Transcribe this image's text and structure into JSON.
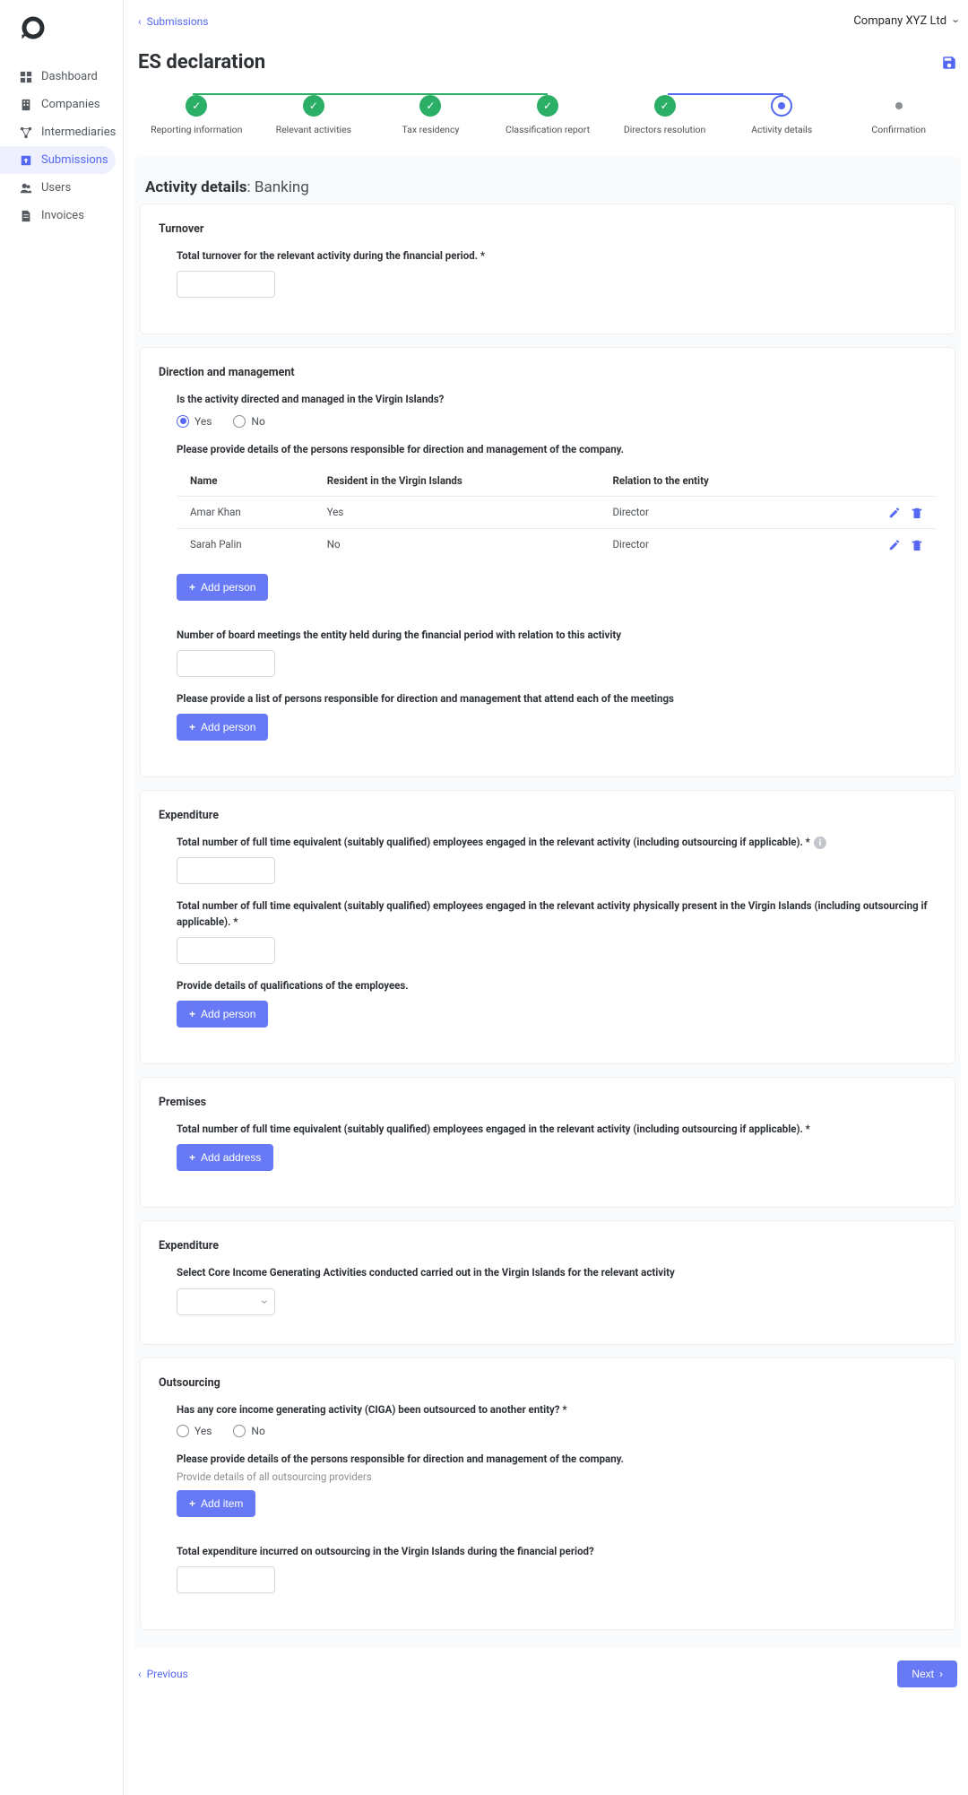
{
  "sidebar": {
    "items": [
      {
        "label": "Dashboard",
        "icon": "dashboard"
      },
      {
        "label": "Companies",
        "icon": "companies"
      },
      {
        "label": "Intermediaries",
        "icon": "intermediaries"
      },
      {
        "label": "Submissions",
        "icon": "submissions",
        "active": true
      },
      {
        "label": "Users",
        "icon": "users"
      },
      {
        "label": "Invoices",
        "icon": "invoices"
      }
    ]
  },
  "topbar": {
    "back_label": "Submissions",
    "company": "Company XYZ Ltd"
  },
  "header": {
    "title": "ES declaration"
  },
  "stepper": [
    {
      "label": "Reporting information",
      "state": "done"
    },
    {
      "label": "Relevant activities",
      "state": "done"
    },
    {
      "label": "Tax residency",
      "state": "done"
    },
    {
      "label": "Classification report",
      "state": "done"
    },
    {
      "label": "Directors resolution",
      "state": "done"
    },
    {
      "label": "Activity details",
      "state": "current"
    },
    {
      "label": "Confirmation",
      "state": "pending"
    }
  ],
  "section_lead": {
    "prefix": "Activity details",
    "suffix": ": Banking"
  },
  "turnover": {
    "card_title": "Turnover",
    "label": "Total turnover for the relevant activity during the financial period. *"
  },
  "direction": {
    "card_title": "Direction and management",
    "q_directed": "Is the activity directed and managed in the Virgin Islands?",
    "yes": "Yes",
    "no": "No",
    "persons_label": "Please provide details of the persons responsible for direction and management of the company.",
    "table_headers": {
      "name": "Name",
      "resident": "Resident in the Virgin Islands",
      "relation": "Relation to the entity"
    },
    "persons": [
      {
        "name": "Amar Khan",
        "resident": "Yes",
        "relation": "Director"
      },
      {
        "name": "Sarah Palin",
        "resident": "No",
        "relation": "Director"
      }
    ],
    "add_person": "Add person",
    "meetings_label": "Number of board meetings the entity held during the financial period with relation to this activity",
    "attendees_label": "Please provide a list of persons responsible for direction and management that attend each of the meetings"
  },
  "expenditure1": {
    "card_title": "Expenditure",
    "q1": "Total number of full time equivalent (suitably qualified) employees engaged in the relevant activity (including outsourcing if applicable). *",
    "q2": "Total number of full time equivalent (suitably qualified) employees engaged in the relevant activity physically present in the Virgin Islands (including outsourcing if applicable). *",
    "q3": "Provide details of qualifications of the employees.",
    "add_person": "Add person"
  },
  "premises": {
    "card_title": "Premises",
    "q1": "Total number of full time equivalent (suitably qualified) employees engaged in the relevant activity (including outsourcing if applicable). *",
    "add_address": "Add address"
  },
  "expenditure2": {
    "card_title": "Expenditure",
    "q1": "Select Core Income Generating Activities conducted carried out in the Virgin Islands for the relevant activity"
  },
  "outsourcing": {
    "card_title": "Outsourcing",
    "q1": "Has any core income generating activity (CIGA) been outsourced to another entity? *",
    "yes": "Yes",
    "no": "No",
    "q2": "Please provide details of the persons responsible for direction and management of the company.",
    "q2_sub": "Provide details of all outsourcing providers",
    "add_item": "Add item",
    "q3": "Total expenditure incurred on outsourcing in the Virgin Islands during the financial period?"
  },
  "footer": {
    "previous": "Previous",
    "next": "Next"
  }
}
